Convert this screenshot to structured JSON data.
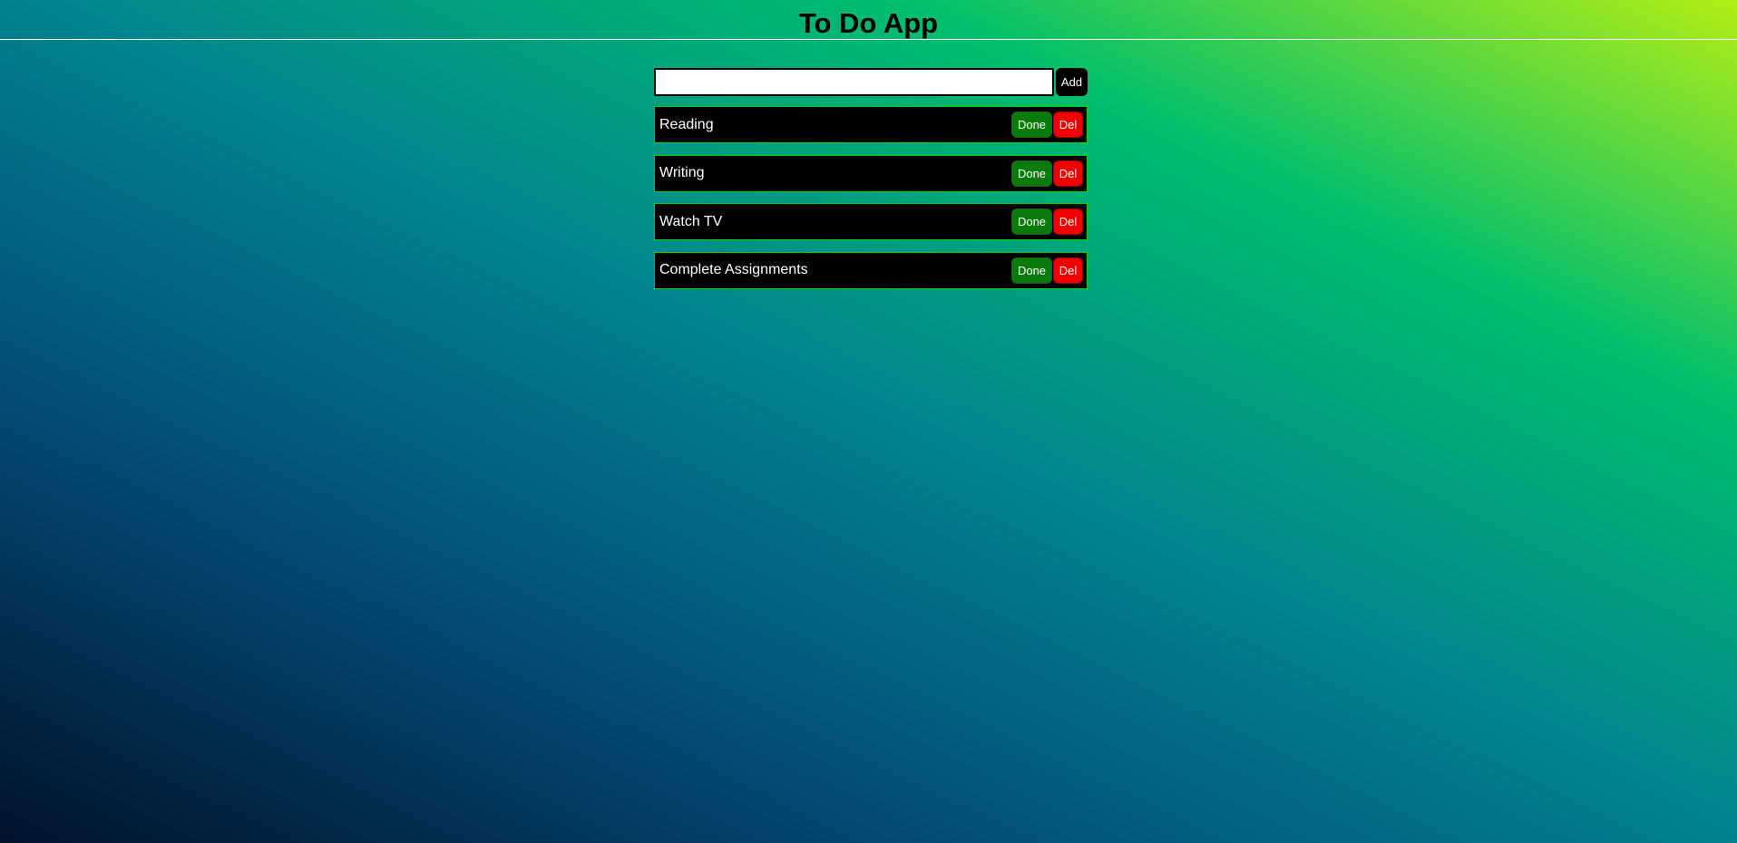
{
  "header": {
    "title": "To Do App"
  },
  "add_form": {
    "input_value": "",
    "input_placeholder": "",
    "add_label": "Add"
  },
  "tasks": [
    {
      "text": "Reading",
      "done_label": "Done",
      "del_label": "Del"
    },
    {
      "text": "Writing",
      "done_label": "Done",
      "del_label": "Del"
    },
    {
      "text": "Watch TV",
      "done_label": "Done",
      "del_label": "Del"
    },
    {
      "text": "Complete Assignments",
      "done_label": "Done",
      "del_label": "Del"
    }
  ],
  "colors": {
    "done_button": "#0a7a0a",
    "del_button": "#f00000",
    "task_border": "#00d000",
    "task_background": "#000000"
  }
}
